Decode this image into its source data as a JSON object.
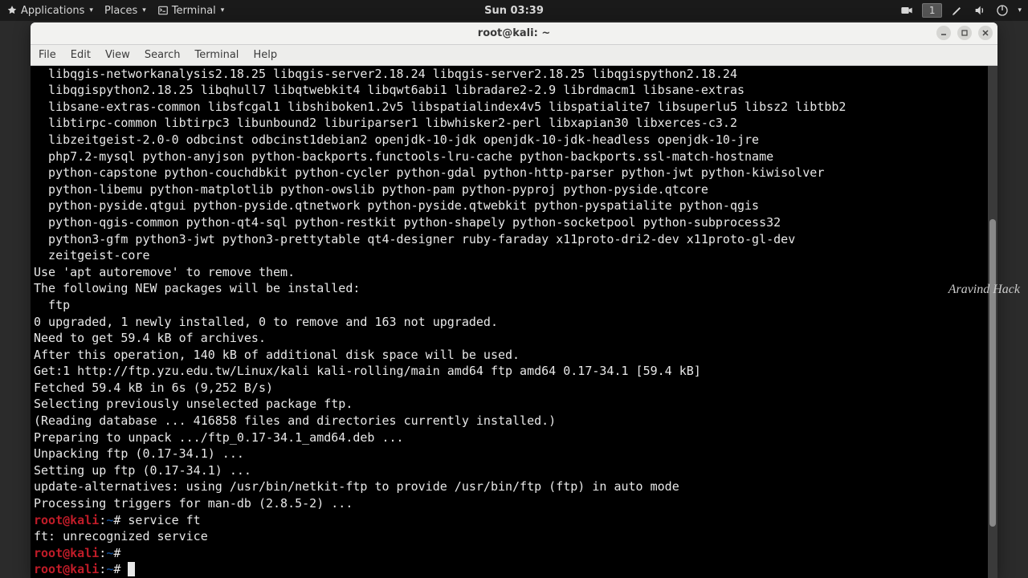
{
  "topbar": {
    "applications": "Applications",
    "places": "Places",
    "terminal": "Terminal",
    "clock": "Sun 03:39",
    "workspace": "1"
  },
  "window": {
    "title": "root@kali: ~"
  },
  "menubar": {
    "file": "File",
    "edit": "Edit",
    "view": "View",
    "search": "Search",
    "terminal": "Terminal",
    "help": "Help"
  },
  "terminal": {
    "lines": [
      "  libqgis-networkanalysis2.18.25 libqgis-server2.18.24 libqgis-server2.18.25 libqgispython2.18.24",
      "  libqgispython2.18.25 libqhull7 libqtwebkit4 libqwt6abi1 libradare2-2.9 librdmacm1 libsane-extras",
      "  libsane-extras-common libsfcgal1 libshiboken1.2v5 libspatialindex4v5 libspatialite7 libsuperlu5 libsz2 libtbb2",
      "  libtirpc-common libtirpc3 libunbound2 liburiparser1 libwhisker2-perl libxapian30 libxerces-c3.2",
      "  libzeitgeist-2.0-0 odbcinst odbcinst1debian2 openjdk-10-jdk openjdk-10-jdk-headless openjdk-10-jre",
      "  php7.2-mysql python-anyjson python-backports.functools-lru-cache python-backports.ssl-match-hostname",
      "  python-capstone python-couchdbkit python-cycler python-gdal python-http-parser python-jwt python-kiwisolver",
      "  python-libemu python-matplotlib python-owslib python-pam python-pyproj python-pyside.qtcore",
      "  python-pyside.qtgui python-pyside.qtnetwork python-pyside.qtwebkit python-pyspatialite python-qgis",
      "  python-qgis-common python-qt4-sql python-restkit python-shapely python-socketpool python-subprocess32",
      "  python3-gfm python3-jwt python3-prettytable qt4-designer ruby-faraday x11proto-dri2-dev x11proto-gl-dev",
      "  zeitgeist-core",
      "Use 'apt autoremove' to remove them.",
      "The following NEW packages will be installed:",
      "  ftp",
      "0 upgraded, 1 newly installed, 0 to remove and 163 not upgraded.",
      "Need to get 59.4 kB of archives.",
      "After this operation, 140 kB of additional disk space will be used.",
      "Get:1 http://ftp.yzu.edu.tw/Linux/kali kali-rolling/main amd64 ftp amd64 0.17-34.1 [59.4 kB]",
      "Fetched 59.4 kB in 6s (9,252 B/s)",
      "Selecting previously unselected package ftp.",
      "(Reading database ... 416858 files and directories currently installed.)",
      "Preparing to unpack .../ftp_0.17-34.1_amd64.deb ...",
      "Unpacking ftp (0.17-34.1) ...",
      "Setting up ftp (0.17-34.1) ...",
      "update-alternatives: using /usr/bin/netkit-ftp to provide /usr/bin/ftp (ftp) in auto mode",
      "Processing triggers for man-db (2.8.5-2) ..."
    ],
    "prompt_user": "root@kali",
    "prompt_path": "~",
    "cmd1": "service ft",
    "err1": "ft: unrecognized service"
  },
  "watermark": "Aravind Hack"
}
